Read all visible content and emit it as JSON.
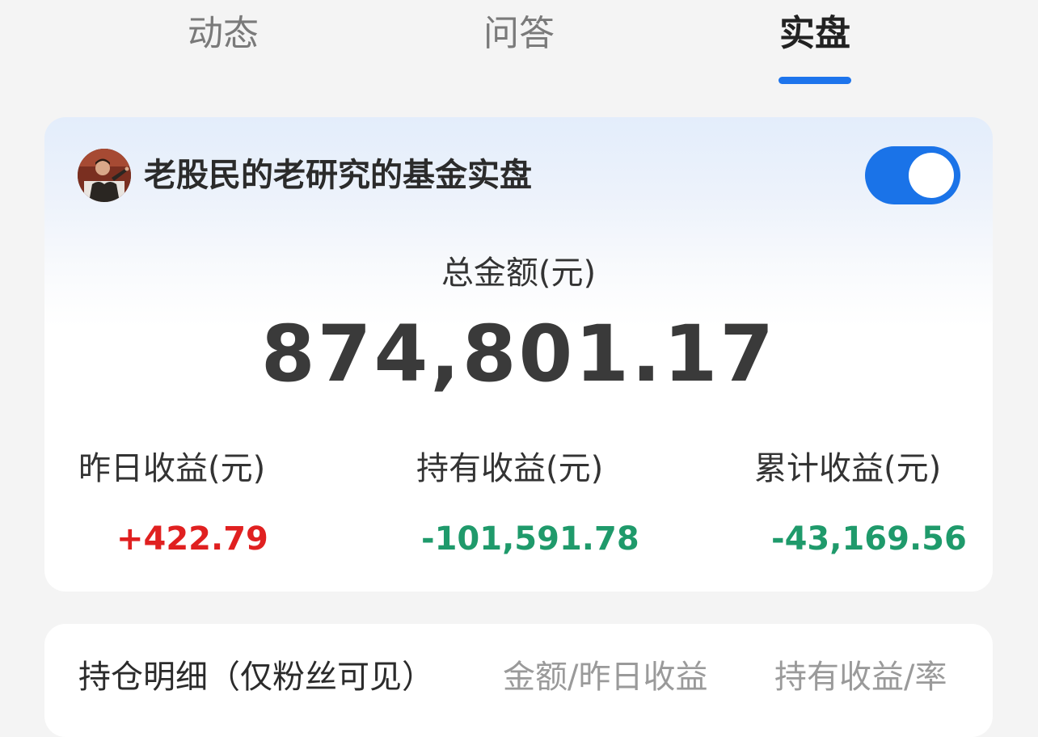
{
  "tabs": [
    {
      "label": "动态"
    },
    {
      "label": "问答"
    },
    {
      "label": "实盘",
      "active": true
    }
  ],
  "colors": {
    "accent": "#1d74ec",
    "profit": "#e02020",
    "loss": "#1f9a6b"
  },
  "account": {
    "title": "老股民的老研究的基金实盘",
    "toggle_on": true
  },
  "summary": {
    "total_label": "总金额(元)",
    "total_value": "874,801.17"
  },
  "stats": [
    {
      "label": "昨日收益(元)",
      "value": "+422.79"
    },
    {
      "label": "持有收益(元)",
      "value": "-101,591.78"
    },
    {
      "label": "累计收益(元)",
      "value": "-43,169.56"
    }
  ],
  "holdings": {
    "title": "持仓明细（仅粉丝可见）",
    "col1": "金额/昨日收益",
    "col2": "持有收益/率"
  }
}
